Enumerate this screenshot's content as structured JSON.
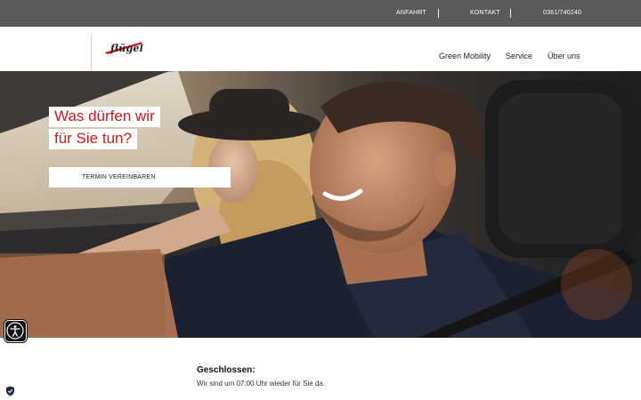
{
  "topbar": {
    "links": [
      {
        "label": "ANFAHRT"
      },
      {
        "label": "KONTAKT"
      },
      {
        "label": "0361/740240"
      }
    ]
  },
  "header": {
    "logo_text": "flügel",
    "nav": [
      {
        "label": "Green Mobility"
      },
      {
        "label": "Service"
      },
      {
        "label": "Über uns"
      }
    ]
  },
  "hero": {
    "title_line1": "Was dürfen wir",
    "title_line2": "für Sie tun?",
    "cta_label": "TERMIN VEREINBAREN"
  },
  "icons": {
    "accessibility": "accessibility-icon",
    "privacy": "shield-check-icon"
  },
  "status": {
    "title": "Geschlossen:",
    "text": "Wir sind um 07:00 Uhr wieder für Sie da."
  },
  "colors": {
    "topbar": "#5a5a5a",
    "accent_red": "#d3161c"
  }
}
